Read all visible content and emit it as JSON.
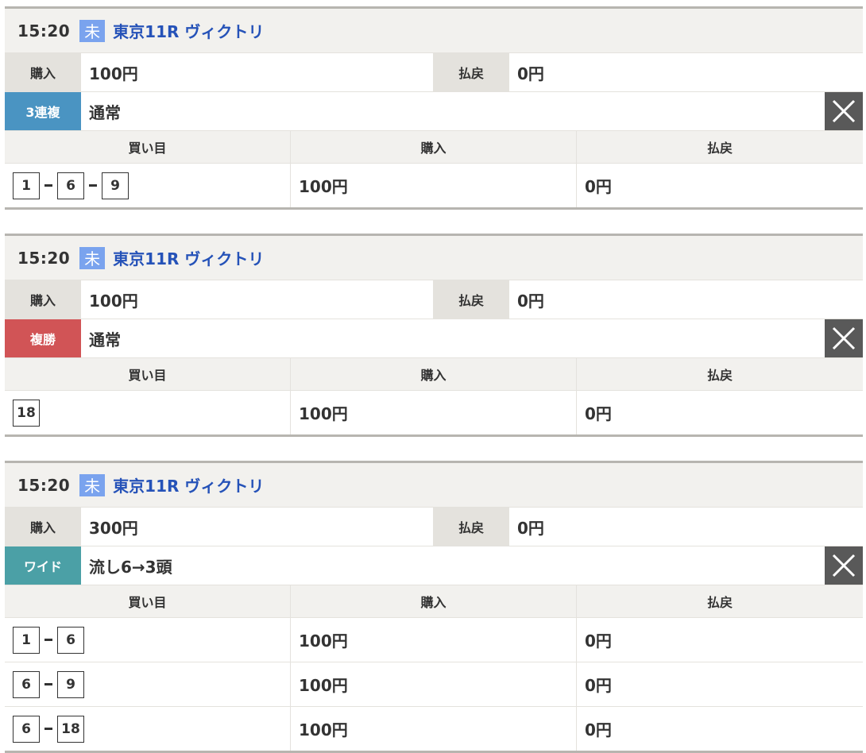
{
  "labels": {
    "purchase": "購入",
    "payout": "払戻",
    "bet_combo": "買い目"
  },
  "colors": {
    "sanrenpuku": "#4a94c2",
    "fukusho": "#d15456",
    "wide": "#4ba0a6",
    "status": "#7aa3ee",
    "race": "#2552b8"
  },
  "cards": [
    {
      "time": "15:20",
      "status": "未",
      "race": "東京11R ヴィクトリ",
      "purchase": "100円",
      "payout": "0円",
      "type_label": "3連複",
      "type_value": "通常",
      "rows": [
        {
          "combo": [
            "1",
            "6",
            "9"
          ],
          "purchase": "100円",
          "payout": "0円"
        }
      ]
    },
    {
      "time": "15:20",
      "status": "未",
      "race": "東京11R ヴィクトリ",
      "purchase": "100円",
      "payout": "0円",
      "type_label": "複勝",
      "type_value": "通常",
      "rows": [
        {
          "combo": [
            "18"
          ],
          "purchase": "100円",
          "payout": "0円"
        }
      ]
    },
    {
      "time": "15:20",
      "status": "未",
      "race": "東京11R ヴィクトリ",
      "purchase": "300円",
      "payout": "0円",
      "type_label": "ワイド",
      "type_value": "流し6→3頭",
      "rows": [
        {
          "combo": [
            "1",
            "6"
          ],
          "purchase": "100円",
          "payout": "0円"
        },
        {
          "combo": [
            "6",
            "9"
          ],
          "purchase": "100円",
          "payout": "0円"
        },
        {
          "combo": [
            "6",
            "18"
          ],
          "purchase": "100円",
          "payout": "0円"
        }
      ]
    }
  ]
}
